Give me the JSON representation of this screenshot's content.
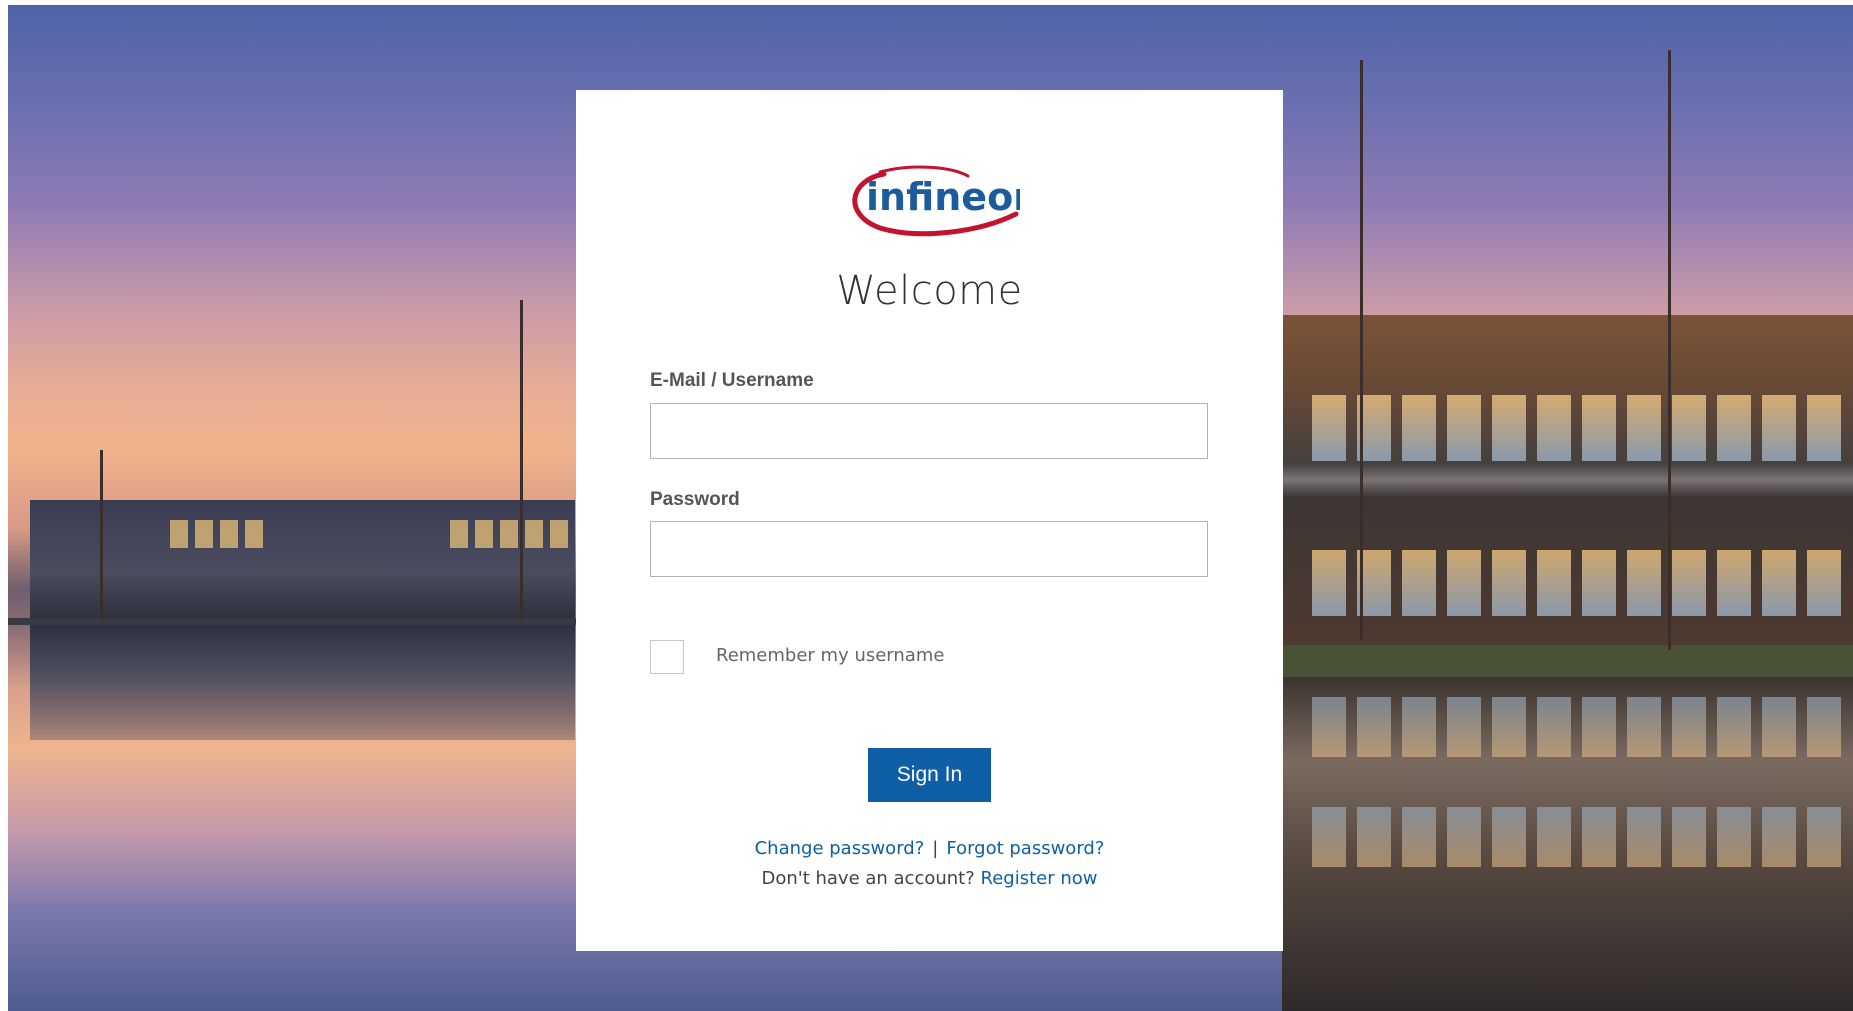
{
  "brand": {
    "logo_text": "infineon",
    "colors": {
      "primary_blue": "#0f5fa6",
      "logo_red": "#c4122f",
      "logo_blue": "#1d5c9c"
    }
  },
  "login": {
    "welcome": "Welcome",
    "username_label": "E-Mail / Username",
    "username_value": "",
    "password_label": "Password",
    "password_value": "",
    "remember_label": "Remember my username",
    "remember_checked": false,
    "sign_in_label": "Sign In",
    "change_password": "Change password?",
    "separator": "|",
    "forgot_password": "Forgot password?",
    "no_account_text": "Don't have an account?",
    "register_now": "Register now"
  }
}
